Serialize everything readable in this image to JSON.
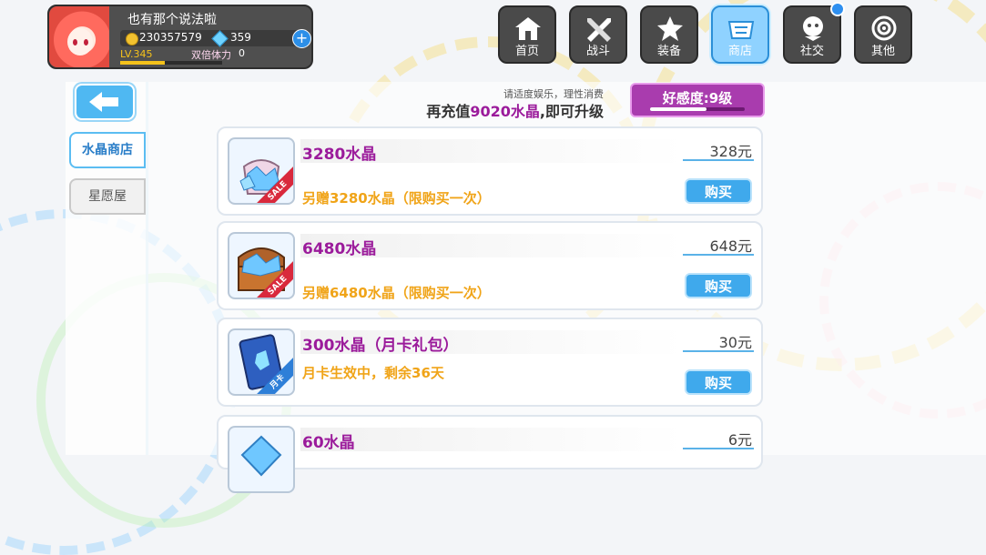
{
  "player": {
    "name": "也有那个说法啦",
    "gold": "230357579",
    "crystals": "359",
    "level": "LV.345",
    "double_stamina_label": "双倍体力",
    "double_stamina_value": "0"
  },
  "nav": [
    {
      "label": "首页",
      "icon": "home-icon"
    },
    {
      "label": "战斗",
      "icon": "battle-icon"
    },
    {
      "label": "装备",
      "icon": "equipment-icon"
    },
    {
      "label": "商店",
      "icon": "shop-icon",
      "active": true
    },
    {
      "label": "社交",
      "icon": "social-icon"
    },
    {
      "label": "其他",
      "icon": "other-icon"
    }
  ],
  "sidebar": {
    "back_icon": "back-arrow-icon",
    "tabs": [
      {
        "label": "水晶商店",
        "active": true
      },
      {
        "label": "星愿屋",
        "active": false
      }
    ]
  },
  "header": {
    "tip": "请适度娱乐，理性消费",
    "upgrade_prefix": "再充值",
    "upgrade_amount": "9020水晶",
    "upgrade_suffix": ",即可升级",
    "favor": "好感度:9级"
  },
  "items": [
    {
      "name": "3280水晶",
      "desc": "另赠3280水晶（限购买一次）",
      "price": "328元",
      "buy": "购买",
      "sale": "SALE"
    },
    {
      "name": "6480水晶",
      "desc": "另赠6480水晶（限购买一次）",
      "price": "648元",
      "buy": "购买",
      "sale": "SALE"
    },
    {
      "name": "300水晶（月卡礼包）",
      "desc": "月卡生效中，剩余36天",
      "price": "30元",
      "buy": "购买",
      "badge": "月卡"
    },
    {
      "name": "60水晶",
      "price": "6元"
    }
  ],
  "colors": {
    "accent": "#3fa9ec",
    "purple": "#9b1b9b",
    "orange": "#f0a418"
  }
}
